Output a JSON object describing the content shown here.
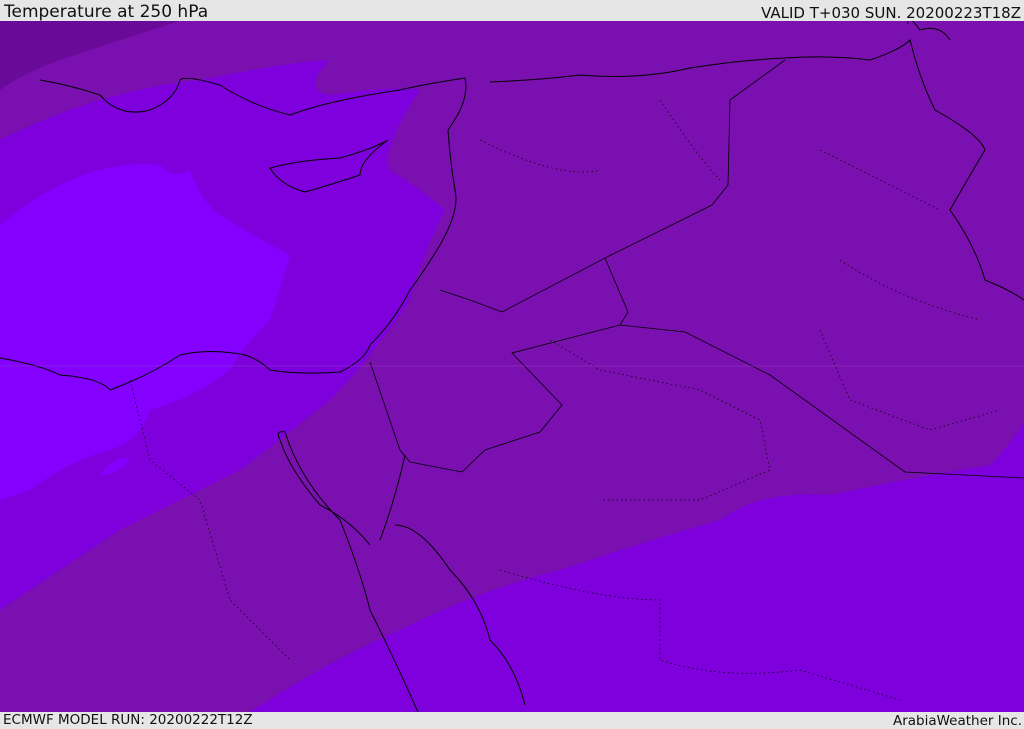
{
  "header": {
    "title": "Temperature at 250 hPa",
    "valid_time": "VALID T+030 SUN. 20200223T18Z"
  },
  "footer": {
    "model_run": "ECMWF MODEL RUN: 20200222T12Z",
    "credit": "ArabiaWeather Inc."
  },
  "map": {
    "colors": {
      "coldest": "#6a0a98",
      "cold": "#7a10b0",
      "mild": "#7e00dc",
      "warm": "#8400ff",
      "coastline": "#000000"
    }
  }
}
